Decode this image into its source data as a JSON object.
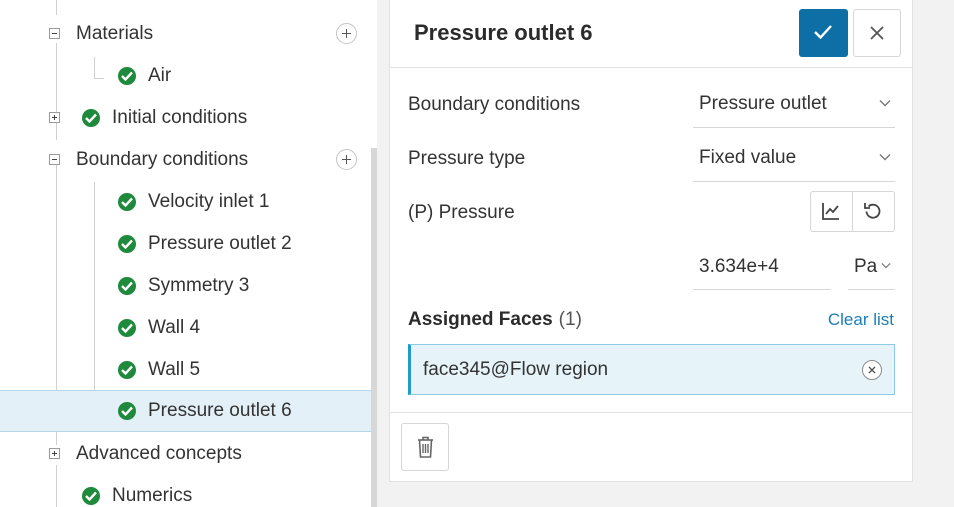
{
  "tree": {
    "items": [
      {
        "label": "Materials",
        "expander": "minus",
        "has_add": true
      },
      {
        "label": "Air",
        "checked": true
      },
      {
        "label": "Initial conditions",
        "expander": "plus",
        "checked": true
      },
      {
        "label": "Boundary conditions",
        "expander": "minus",
        "has_add": true
      },
      {
        "label": "Velocity inlet 1",
        "checked": true
      },
      {
        "label": "Pressure outlet 2",
        "checked": true
      },
      {
        "label": "Symmetry 3",
        "checked": true
      },
      {
        "label": "Wall 4",
        "checked": true
      },
      {
        "label": "Wall 5",
        "checked": true
      },
      {
        "label": "Pressure outlet 6",
        "checked": true,
        "selected": true
      },
      {
        "label": "Advanced concepts",
        "expander": "plus"
      },
      {
        "label": "Numerics",
        "checked": true
      }
    ]
  },
  "panel": {
    "title": "Pressure outlet 6",
    "fields": {
      "boundary_conditions": {
        "label": "Boundary conditions",
        "value": "Pressure outlet"
      },
      "pressure_type": {
        "label": "Pressure type",
        "value": "Fixed value"
      },
      "pressure": {
        "label": "(P) Pressure",
        "value": "3.634e+4",
        "unit": "Pa"
      }
    },
    "assigned_faces": {
      "title": "Assigned Faces",
      "count": "(1)",
      "clear_label": "Clear list",
      "items": [
        "face345@Flow region"
      ]
    }
  },
  "icons": {
    "confirm": "check-icon",
    "close": "close-icon",
    "chart": "chart-icon",
    "reset": "reset-icon",
    "delete": "trash-icon",
    "remove": "remove-icon",
    "chevron": "chevron-down-icon"
  },
  "colors": {
    "accent": "#0e6fa6",
    "success": "#1f8a3c",
    "link": "#1a7fb5",
    "selection": "#e3f0f8"
  }
}
